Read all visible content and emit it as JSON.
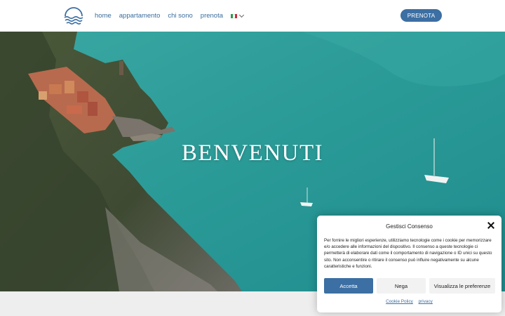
{
  "header": {
    "nav": [
      {
        "label": "home"
      },
      {
        "label": "appartamento"
      },
      {
        "label": "chi sono"
      },
      {
        "label": "prenota"
      }
    ],
    "language_flag": "it-flag-icon",
    "cta_label": "PRENOTA"
  },
  "hero": {
    "title": "BENVENUTI"
  },
  "consent": {
    "title": "Gestisci Consenso",
    "text": "Per fornire le migliori esperienze, utilizziamo tecnologie come i cookie per memorizzare e/o accedere alle informazioni del dispositivo. Il consenso a queste tecnologie ci permetterà di elaborare dati come il comportamento di navigazione o ID unici su questo sito. Non acconsentire o ritirare il consenso può influire negativamente su alcune caratteristiche e funzioni.",
    "accept_label": "Accetta",
    "deny_label": "Nega",
    "prefs_label": "Visualizza le preferenze",
    "cookie_policy_label": "Cookie Policy",
    "privacy_label": "privacy"
  },
  "colors": {
    "brand_blue": "#3c6fa3",
    "nav_text": "#3b6d9c",
    "sea": "#2d9e9a"
  }
}
